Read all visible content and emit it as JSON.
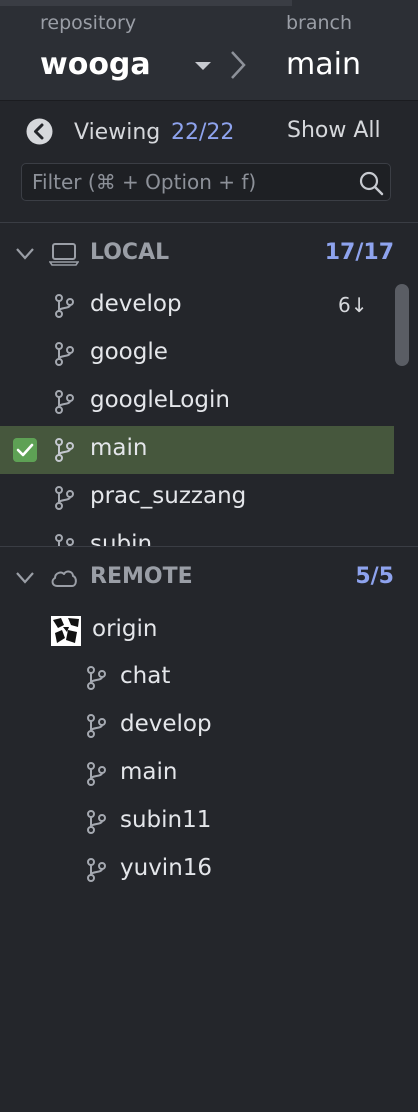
{
  "header": {
    "repository_caption": "repository",
    "repository_name": "wooga",
    "branch_caption": "branch",
    "branch_name": "main"
  },
  "viewing": {
    "label": "Viewing",
    "count": "22/22",
    "show_all": "Show All"
  },
  "filter": {
    "placeholder": "Filter (⌘ + Option + f)",
    "value": ""
  },
  "local": {
    "label": "LOCAL",
    "count": "17/17",
    "branches": [
      {
        "name": "develop",
        "badge": "6↓"
      },
      {
        "name": "google",
        "badge": ""
      },
      {
        "name": "googleLogin",
        "badge": ""
      },
      {
        "name": "main",
        "badge": "",
        "selected": true
      },
      {
        "name": "prac_suzzang",
        "badge": ""
      },
      {
        "name": "subin",
        "badge": ""
      }
    ]
  },
  "remote": {
    "label": "REMOTE",
    "count": "5/5",
    "origin": "origin",
    "branches": [
      {
        "name": "chat"
      },
      {
        "name": "develop"
      },
      {
        "name": "main"
      },
      {
        "name": "subin11"
      },
      {
        "name": "yuvin16"
      }
    ]
  },
  "colors": {
    "background": "#24262b",
    "accent_count": "#8ea3ee",
    "selected_row": "#46573d",
    "checkbox": "#5ea155"
  }
}
